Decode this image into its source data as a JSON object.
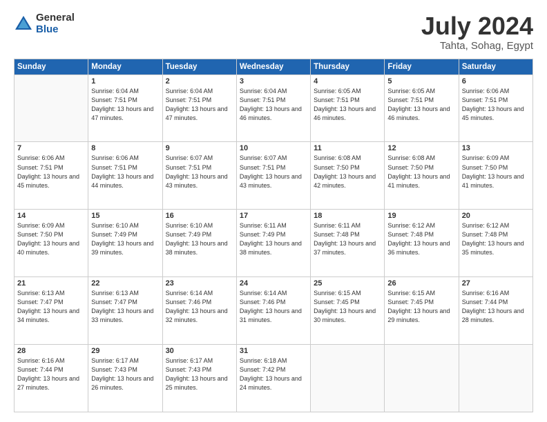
{
  "logo": {
    "general": "General",
    "blue": "Blue"
  },
  "header": {
    "title": "July 2024",
    "subtitle": "Tahta, Sohag, Egypt"
  },
  "days_of_week": [
    "Sunday",
    "Monday",
    "Tuesday",
    "Wednesday",
    "Thursday",
    "Friday",
    "Saturday"
  ],
  "weeks": [
    [
      {
        "day": "",
        "info": ""
      },
      {
        "day": "1",
        "info": "Sunrise: 6:04 AM\nSunset: 7:51 PM\nDaylight: 13 hours and 47 minutes."
      },
      {
        "day": "2",
        "info": "Sunrise: 6:04 AM\nSunset: 7:51 PM\nDaylight: 13 hours and 47 minutes."
      },
      {
        "day": "3",
        "info": "Sunrise: 6:04 AM\nSunset: 7:51 PM\nDaylight: 13 hours and 46 minutes."
      },
      {
        "day": "4",
        "info": "Sunrise: 6:05 AM\nSunset: 7:51 PM\nDaylight: 13 hours and 46 minutes."
      },
      {
        "day": "5",
        "info": "Sunrise: 6:05 AM\nSunset: 7:51 PM\nDaylight: 13 hours and 46 minutes."
      },
      {
        "day": "6",
        "info": "Sunrise: 6:06 AM\nSunset: 7:51 PM\nDaylight: 13 hours and 45 minutes."
      }
    ],
    [
      {
        "day": "7",
        "info": "Sunrise: 6:06 AM\nSunset: 7:51 PM\nDaylight: 13 hours and 45 minutes."
      },
      {
        "day": "8",
        "info": "Sunrise: 6:06 AM\nSunset: 7:51 PM\nDaylight: 13 hours and 44 minutes."
      },
      {
        "day": "9",
        "info": "Sunrise: 6:07 AM\nSunset: 7:51 PM\nDaylight: 13 hours and 43 minutes."
      },
      {
        "day": "10",
        "info": "Sunrise: 6:07 AM\nSunset: 7:51 PM\nDaylight: 13 hours and 43 minutes."
      },
      {
        "day": "11",
        "info": "Sunrise: 6:08 AM\nSunset: 7:50 PM\nDaylight: 13 hours and 42 minutes."
      },
      {
        "day": "12",
        "info": "Sunrise: 6:08 AM\nSunset: 7:50 PM\nDaylight: 13 hours and 41 minutes."
      },
      {
        "day": "13",
        "info": "Sunrise: 6:09 AM\nSunset: 7:50 PM\nDaylight: 13 hours and 41 minutes."
      }
    ],
    [
      {
        "day": "14",
        "info": "Sunrise: 6:09 AM\nSunset: 7:50 PM\nDaylight: 13 hours and 40 minutes."
      },
      {
        "day": "15",
        "info": "Sunrise: 6:10 AM\nSunset: 7:49 PM\nDaylight: 13 hours and 39 minutes."
      },
      {
        "day": "16",
        "info": "Sunrise: 6:10 AM\nSunset: 7:49 PM\nDaylight: 13 hours and 38 minutes."
      },
      {
        "day": "17",
        "info": "Sunrise: 6:11 AM\nSunset: 7:49 PM\nDaylight: 13 hours and 38 minutes."
      },
      {
        "day": "18",
        "info": "Sunrise: 6:11 AM\nSunset: 7:48 PM\nDaylight: 13 hours and 37 minutes."
      },
      {
        "day": "19",
        "info": "Sunrise: 6:12 AM\nSunset: 7:48 PM\nDaylight: 13 hours and 36 minutes."
      },
      {
        "day": "20",
        "info": "Sunrise: 6:12 AM\nSunset: 7:48 PM\nDaylight: 13 hours and 35 minutes."
      }
    ],
    [
      {
        "day": "21",
        "info": "Sunrise: 6:13 AM\nSunset: 7:47 PM\nDaylight: 13 hours and 34 minutes."
      },
      {
        "day": "22",
        "info": "Sunrise: 6:13 AM\nSunset: 7:47 PM\nDaylight: 13 hours and 33 minutes."
      },
      {
        "day": "23",
        "info": "Sunrise: 6:14 AM\nSunset: 7:46 PM\nDaylight: 13 hours and 32 minutes."
      },
      {
        "day": "24",
        "info": "Sunrise: 6:14 AM\nSunset: 7:46 PM\nDaylight: 13 hours and 31 minutes."
      },
      {
        "day": "25",
        "info": "Sunrise: 6:15 AM\nSunset: 7:45 PM\nDaylight: 13 hours and 30 minutes."
      },
      {
        "day": "26",
        "info": "Sunrise: 6:15 AM\nSunset: 7:45 PM\nDaylight: 13 hours and 29 minutes."
      },
      {
        "day": "27",
        "info": "Sunrise: 6:16 AM\nSunset: 7:44 PM\nDaylight: 13 hours and 28 minutes."
      }
    ],
    [
      {
        "day": "28",
        "info": "Sunrise: 6:16 AM\nSunset: 7:44 PM\nDaylight: 13 hours and 27 minutes."
      },
      {
        "day": "29",
        "info": "Sunrise: 6:17 AM\nSunset: 7:43 PM\nDaylight: 13 hours and 26 minutes."
      },
      {
        "day": "30",
        "info": "Sunrise: 6:17 AM\nSunset: 7:43 PM\nDaylight: 13 hours and 25 minutes."
      },
      {
        "day": "31",
        "info": "Sunrise: 6:18 AM\nSunset: 7:42 PM\nDaylight: 13 hours and 24 minutes."
      },
      {
        "day": "",
        "info": ""
      },
      {
        "day": "",
        "info": ""
      },
      {
        "day": "",
        "info": ""
      }
    ]
  ]
}
